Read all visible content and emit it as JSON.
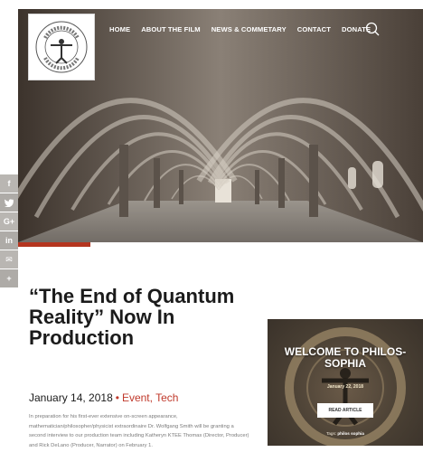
{
  "nav": {
    "logo_text": "PHILOS-SOPHIA INITIATIVE",
    "links": [
      "HOME",
      "ABOUT THE FILM",
      "NEWS & COMMETARY",
      "CONTACT",
      "DONATE"
    ]
  },
  "share": {
    "items": [
      {
        "icon": "facebook-icon",
        "glyph": "f"
      },
      {
        "icon": "twitter-icon",
        "glyph": "t"
      },
      {
        "icon": "googleplus-icon",
        "glyph": "G+"
      },
      {
        "icon": "linkedin-icon",
        "glyph": "in"
      },
      {
        "icon": "email-icon",
        "glyph": "✉"
      },
      {
        "icon": "more-icon",
        "glyph": "+"
      }
    ]
  },
  "article": {
    "title": "“The End of Quantum Reality” Now In Production",
    "date": "January 14, 2018",
    "category_1": "Event",
    "category_sep": ",",
    "category_2": "Tech",
    "excerpt": "In preparation for his first-ever extensive on-screen appearance, mathematician/philosopher/physicist extraordinaire Dr. Wolfgang Smith will be granting a second interview to our production team including Katheryn KTEE Thomas (Director, Producer) and Rick DeLano (Producer, Narrator) on February 1."
  },
  "card": {
    "title": "WELCOME TO PHILOS-SOPHIA",
    "date": "January 22, 2018",
    "button": "READ ARTICLE",
    "tags_label": "Tags:",
    "tags_value": "philos sophia"
  },
  "colors": {
    "accent": "#c0392b",
    "nav_text": "#ffffff"
  }
}
